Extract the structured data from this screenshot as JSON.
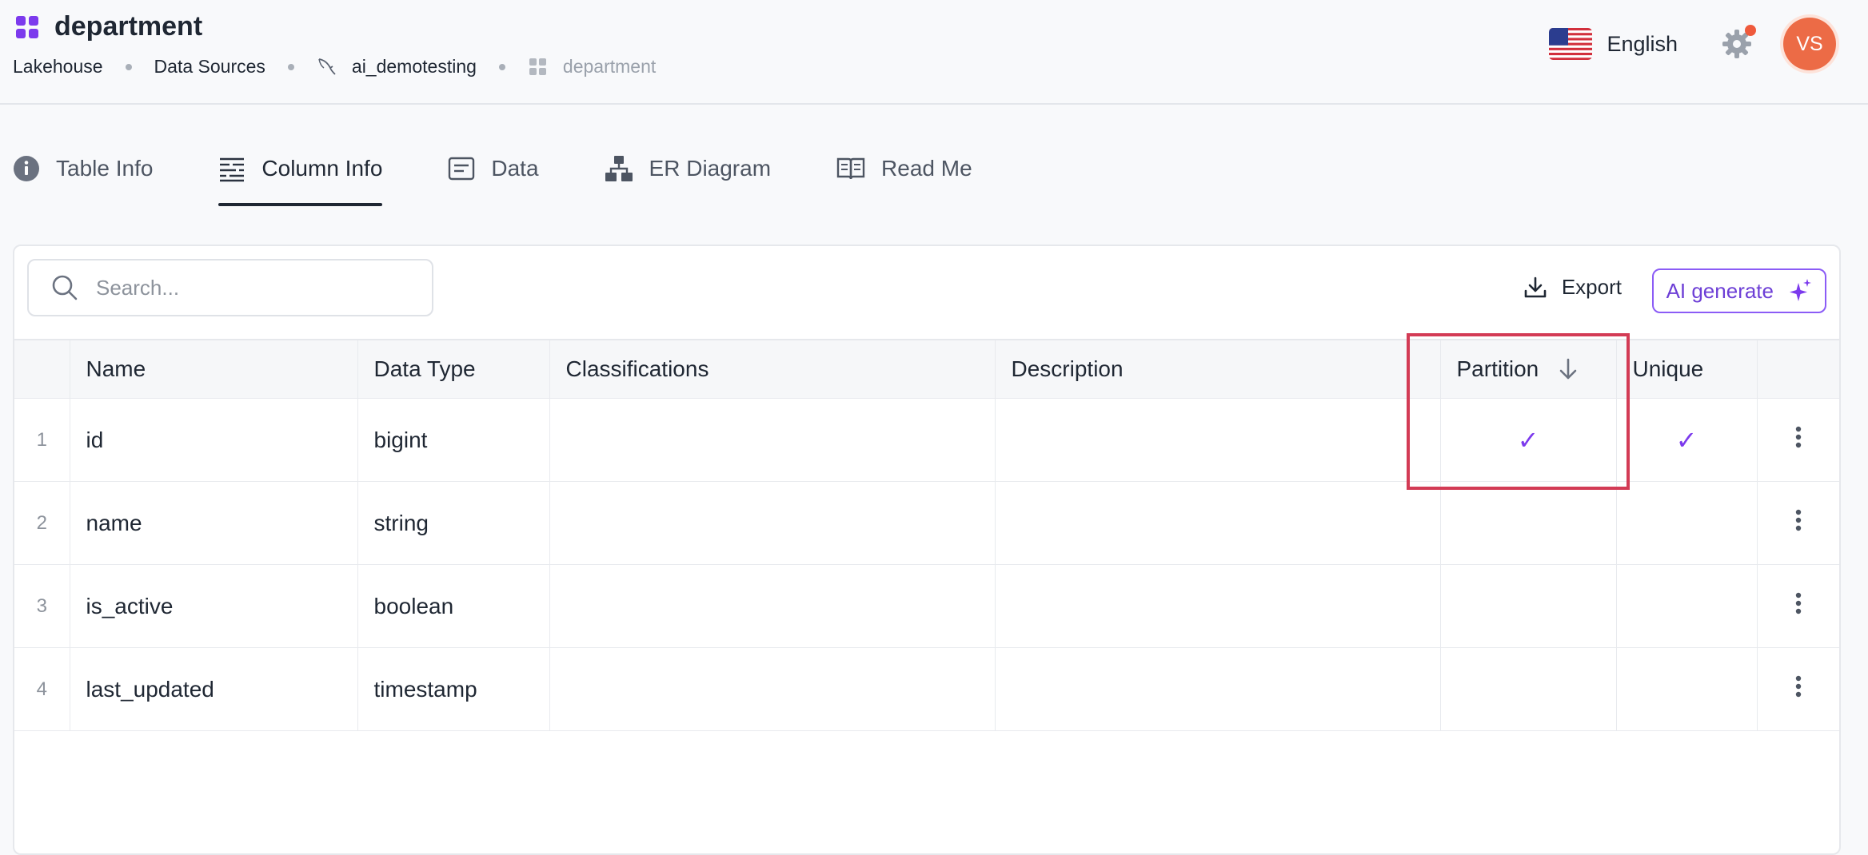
{
  "header": {
    "title": "department",
    "breadcrumb": [
      "Lakehouse",
      "Data Sources",
      "ai_demotesting",
      "department"
    ],
    "language": "English",
    "avatar_initials": "VS"
  },
  "tabs": [
    {
      "label": "Table Info",
      "icon": "info-icon"
    },
    {
      "label": "Column Info",
      "icon": "columns-icon",
      "active": true
    },
    {
      "label": "Data",
      "icon": "data-icon"
    },
    {
      "label": "ER Diagram",
      "icon": "diagram-icon"
    },
    {
      "label": "Read Me",
      "icon": "book-icon"
    }
  ],
  "toolbar": {
    "search_placeholder": "Search...",
    "export_label": "Export",
    "ai_label": "AI generate"
  },
  "table": {
    "headers": {
      "name": "Name",
      "data_type": "Data Type",
      "classifications": "Classifications",
      "description": "Description",
      "partition": "Partition",
      "unique": "Unique"
    },
    "rows": [
      {
        "num": "1",
        "name": "id",
        "type": "bigint",
        "classifications": "",
        "description": "",
        "partition": "✓",
        "unique": "✓"
      },
      {
        "num": "2",
        "name": "name",
        "type": "string",
        "classifications": "",
        "description": "",
        "partition": "",
        "unique": ""
      },
      {
        "num": "3",
        "name": "is_active",
        "type": "boolean",
        "classifications": "",
        "description": "",
        "partition": "",
        "unique": ""
      },
      {
        "num": "4",
        "name": "last_updated",
        "type": "timestamp",
        "classifications": "",
        "description": "",
        "partition": "",
        "unique": ""
      }
    ]
  },
  "colors": {
    "accent": "#7c3aed",
    "avatar_bg": "#ec6b46",
    "notification": "#ef5a3c",
    "highlight": "#d33b55"
  }
}
